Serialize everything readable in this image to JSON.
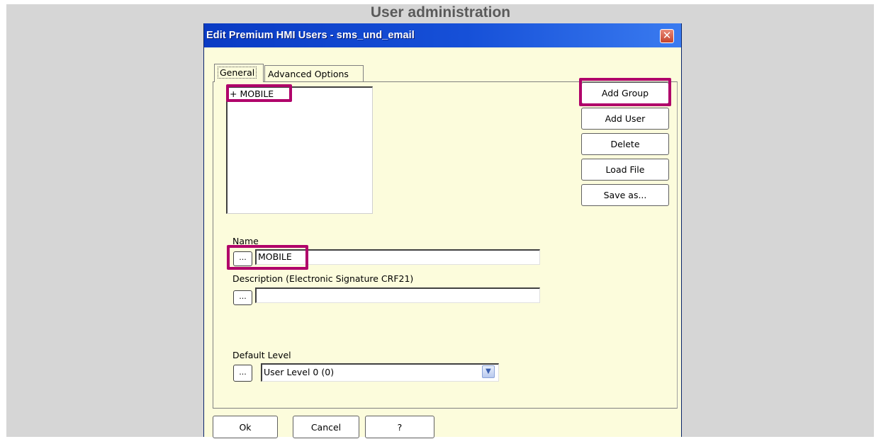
{
  "page": {
    "title": "User administration"
  },
  "dialog": {
    "title": "Edit Premium HMI Users - sms_und_email",
    "close_icon": "close-icon"
  },
  "tabs": [
    {
      "label": "General",
      "selected": true
    },
    {
      "label": "Advanced Options",
      "selected": false
    }
  ],
  "tree": {
    "items": [
      {
        "label": "+ MOBILE"
      }
    ]
  },
  "side_buttons": {
    "add_group": "Add Group",
    "add_user": "Add User",
    "delete": "Delete",
    "load_file": "Load File",
    "save_as": "Save as..."
  },
  "fields": {
    "name": {
      "label": "Name",
      "value": "MOBILE",
      "browse": "..."
    },
    "description": {
      "label": "Description (Electronic Signature CRF21)",
      "value": "",
      "browse": "..."
    },
    "default_level": {
      "label": "Default Level",
      "value": "User Level 0 (0)",
      "browse": "..."
    }
  },
  "bottom_buttons": {
    "ok": "Ok",
    "cancel": "Cancel",
    "help": "?"
  },
  "colors": {
    "highlight": "#b0006a",
    "dialog_bg": "#fcfcdc",
    "titlebar": "#0a3bc4"
  }
}
